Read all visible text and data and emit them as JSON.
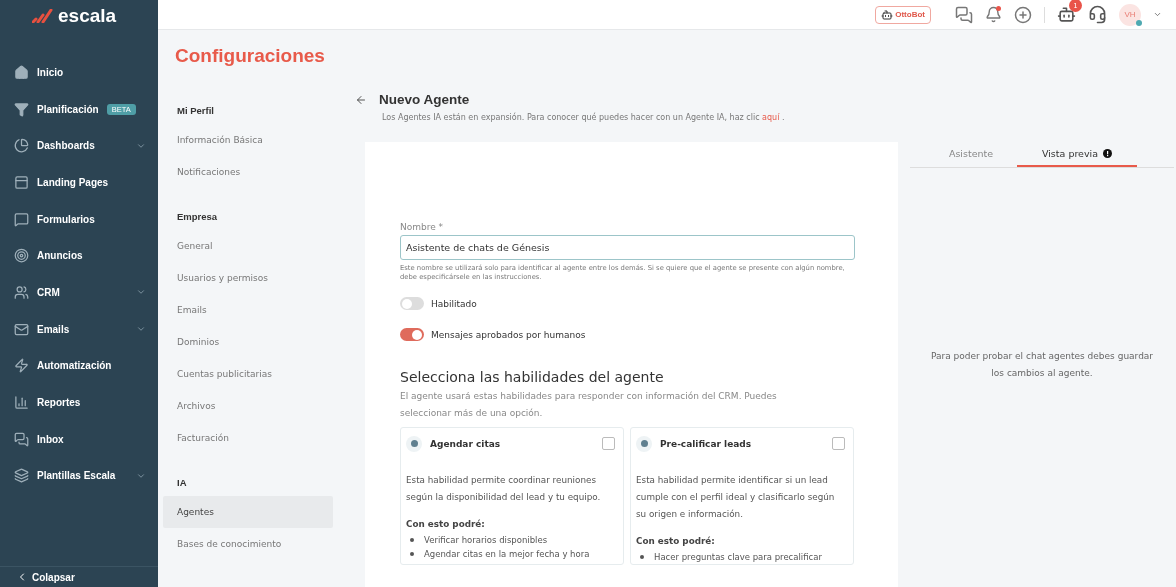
{
  "sidebar": {
    "logo": "escala",
    "items": [
      {
        "label": "Inicio",
        "expandable": false
      },
      {
        "label": "Planificación",
        "badge": "BETA",
        "expandable": false
      },
      {
        "label": "Dashboards",
        "expandable": true
      },
      {
        "label": "Landing Pages",
        "expandable": false
      },
      {
        "label": "Formularios",
        "expandable": false
      },
      {
        "label": "Anuncios",
        "expandable": false
      },
      {
        "label": "CRM",
        "expandable": true
      },
      {
        "label": "Emails",
        "expandable": true
      },
      {
        "label": "Automatización",
        "expandable": false
      },
      {
        "label": "Reportes",
        "expandable": false
      },
      {
        "label": "Inbox",
        "expandable": false
      },
      {
        "label": "Plantillas Escala",
        "expandable": true
      }
    ],
    "collapse": "Colapsar"
  },
  "topbar": {
    "bot_label": "OttoBot",
    "bell_dot": true,
    "robot_badge": "1",
    "avatar": "VH",
    "avatar_online": true
  },
  "page_title": "Configuraciones",
  "settings_nav": [
    {
      "heading": "Mi Perfil",
      "items": [
        {
          "label": "Información Básica",
          "selected": false
        },
        {
          "label": "Notificaciones",
          "selected": false
        }
      ]
    },
    {
      "heading": "Empresa",
      "items": [
        {
          "label": "General",
          "selected": false
        },
        {
          "label": "Usuarios y permisos",
          "selected": false
        },
        {
          "label": "Emails",
          "selected": false
        },
        {
          "label": "Dominios",
          "selected": false
        },
        {
          "label": "Cuentas publicitarias",
          "selected": false
        },
        {
          "label": "Archivos",
          "selected": false
        },
        {
          "label": "Facturación",
          "selected": false
        }
      ]
    },
    {
      "heading": "IA",
      "items": [
        {
          "label": "Agentes",
          "selected": true
        },
        {
          "label": "Bases de conocimiento",
          "selected": false
        }
      ]
    }
  ],
  "agent": {
    "title": "Nuevo Agente",
    "description": "Los Agentes IA están en expansión. Para conocer qué puedes hacer con un Agente IA, haz clic",
    "link": "aquí",
    "description_end": ".",
    "name_field": {
      "label": "Nombre *",
      "value": "Asistente de chats de Génesis",
      "help": "Este nombre se utilizará solo para identificar al agente entre los demás. Si se quiere que el agente se presente con algún nombre, debe especificársele en las instrucciones."
    },
    "toggles": [
      {
        "label": "Habilitado",
        "on": false
      },
      {
        "label": "Mensajes aprobados por humanos",
        "on": true
      }
    ],
    "skills": {
      "heading": "Selecciona las habilidades del agente",
      "description": "El agente usará estas habilidades para responder con información del CRM. Puedes seleccionar más de una opción.",
      "cards": [
        {
          "title": "Agendar citas",
          "checked": false,
          "description": "Esta habilidad permite coordinar reuniones según la disponibilidad del lead y tu equipo.",
          "list_heading": "Con esto podré:",
          "bullets": [
            "Verificar horarios disponibles",
            "Agendar citas en la mejor fecha y hora"
          ]
        },
        {
          "title": "Pre-calificar leads",
          "checked": false,
          "description": "Esta habilidad permite identificar si un lead cumple con el perfil ideal y clasificarlo según su origen e información.",
          "list_heading": "Con esto podré:",
          "bullets": [
            "Hacer preguntas clave para precalificar"
          ]
        }
      ]
    }
  },
  "preview": {
    "tabs": [
      {
        "label": "Asistente",
        "selected": false,
        "alert": false
      },
      {
        "label": "Vista previa",
        "selected": true,
        "alert": true
      }
    ],
    "message": "Para poder probar el chat agentes debes guardar los cambios al agente."
  }
}
